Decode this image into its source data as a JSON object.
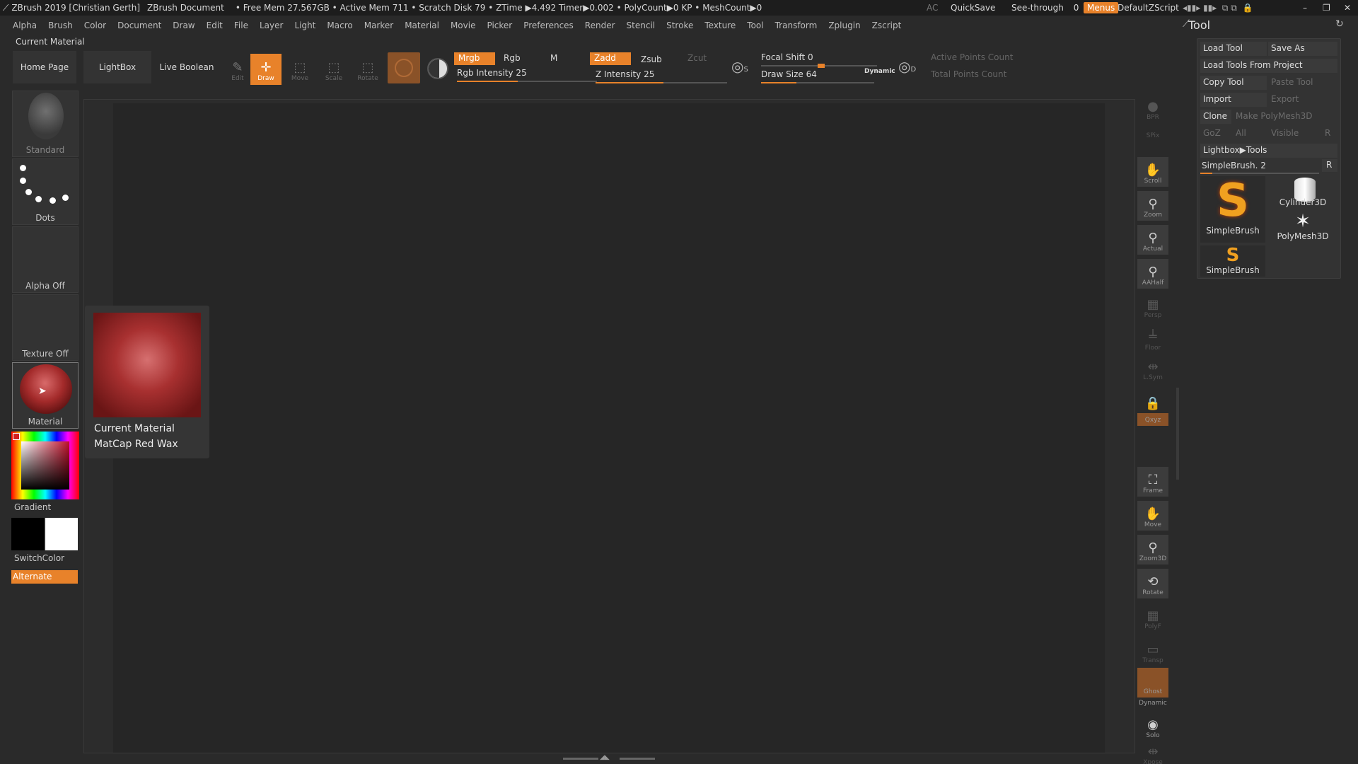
{
  "titlebar": {
    "app": "ZBrush 2019 [Christian Gerth]",
    "doc": "ZBrush Document",
    "stats": "• Free Mem 27.567GB • Active Mem 711 • Scratch Disk 79 • ZTime ▶4.492 Timer▶0.002 • PolyCount▶0 KP • MeshCount▶0",
    "ac": "AC",
    "quicksave": "QuickSave",
    "seethrough": "See-through",
    "seethrough_value": "0",
    "menus": "Menus",
    "script": "DefaultZScript"
  },
  "menubar": [
    "Alpha",
    "Brush",
    "Color",
    "Document",
    "Draw",
    "Edit",
    "File",
    "Layer",
    "Light",
    "Macro",
    "Marker",
    "Material",
    "Movie",
    "Picker",
    "Preferences",
    "Render",
    "Stencil",
    "Stroke",
    "Texture",
    "Tool",
    "Transform",
    "Zplugin",
    "Zscript"
  ],
  "current_material_label": "Current Material",
  "toolbar": {
    "home": "Home Page",
    "lightbox": "LightBox",
    "live_boolean": "Live Boolean",
    "edit": "Edit",
    "draw": "Draw",
    "move": "Move",
    "scale": "Scale",
    "rotate": "Rotate",
    "mrgb": "Mrgb",
    "rgb": "Rgb",
    "m": "M",
    "rgb_intensity": "Rgb Intensity 25",
    "zadd": "Zadd",
    "zsub": "Zsub",
    "zcut": "Zcut",
    "z_intensity": "Z Intensity 25",
    "focal_shift": "Focal Shift 0",
    "draw_size": "Draw Size 64",
    "dynamic": "Dynamic",
    "active_points": "Active Points Count",
    "total_points": "Total Points Count",
    "s": "S",
    "d": "D"
  },
  "left_shelf": {
    "standard": "Standard",
    "dots": "Dots",
    "alpha_off": "Alpha Off",
    "texture_off": "Texture Off",
    "material": "Material",
    "gradient": "Gradient",
    "switchcolor": "SwitchColor",
    "alternate": "Alternate"
  },
  "popup": {
    "title": "Current Material",
    "name": "MatCap Red Wax"
  },
  "right_strip": [
    "BPR",
    "SPix",
    "Scroll",
    "Zoom",
    "Actual",
    "AAHalf",
    "Persp",
    "Floor",
    "L.Sym",
    "",
    "Qxyz",
    "",
    "",
    "Frame",
    "Move",
    "Zoom3D",
    "Rotate",
    "PolyF",
    "Transp",
    "Ghost",
    "Dynamic",
    "Solo",
    "Xpose"
  ],
  "tool_palette": {
    "title": "Tool",
    "load_tool": "Load Tool",
    "save_as": "Save As",
    "load_from_project": "Load Tools From Project",
    "copy_tool": "Copy Tool",
    "paste_tool": "Paste Tool",
    "import": "Import",
    "export": "Export",
    "clone": "Clone",
    "make_polymesh": "Make PolyMesh3D",
    "goz": "GoZ",
    "all": "All",
    "visible": "Visible",
    "r": "R",
    "lightbox_tools": "Lightbox▶Tools",
    "simplebrush_slider": "SimpleBrush. 2",
    "simplebrush_slider_level": 0.1,
    "thumbs": [
      "SimpleBrush",
      "Cylinder3D",
      "PolyMesh3D",
      "SimpleBrush"
    ]
  },
  "colors": {
    "accent": "#e8822a",
    "material": "#a32a2a"
  }
}
